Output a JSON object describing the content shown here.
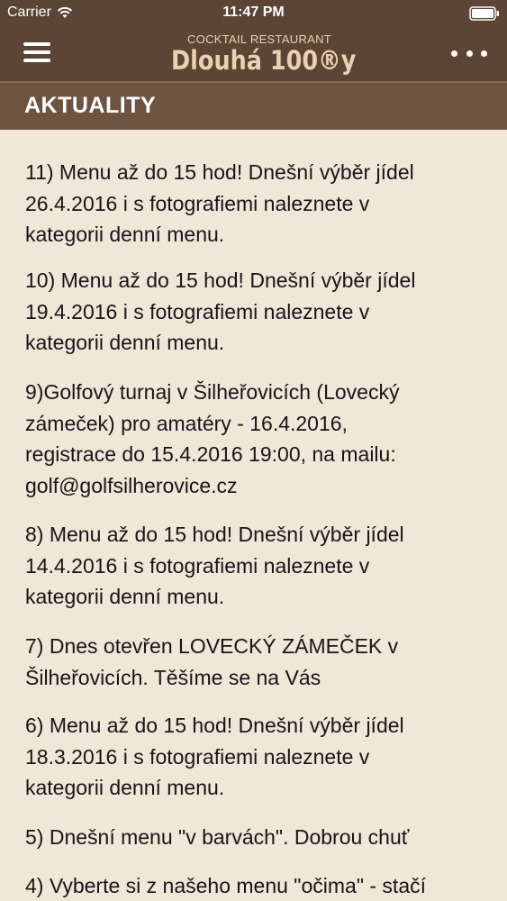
{
  "status_bar": {
    "carrier": "Carrier",
    "time": "11:47 PM"
  },
  "header": {
    "logo_top": "COCKTAIL RESTAURANT",
    "logo_main": "Dlouhá 100®y"
  },
  "section": {
    "title": "AKTUALITY"
  },
  "news": [
    "11) Menu až do 15 hod! Dnešní výběr jídel\n26.4.2016 i s fotografiemi naleznete v\nkategorii denní menu.",
    "10) Menu až do 15 hod! Dnešní výběr jídel\n19.4.2016 i s fotografiemi naleznete v\nkategorii denní menu.",
    "9)Golfový turnaj v Šilheřovicích (Lovecký\nzámeček) pro amatéry - 16.4.2016,\nregistrace do 15.4.2016 19:00, na mailu:\ngolf@golfsilherovice.cz",
    "8) Menu až do 15 hod! Dnešní výběr jídel\n14.4.2016 i s fotografiemi naleznete v\nkategorii denní menu.",
    "7) Dnes otevřen LOVECKÝ ZÁMEČEK v\nŠilheřovicích. Těšíme se na Vás",
    "6) Menu až do 15 hod! Dnešní výběr jídel\n18.3.2016 i s fotografiemi naleznete v\nkategorii denní menu.",
    "5) Dnešní menu \"v barvách\". Dobrou chuť",
    "4) Vyberte si z našeho menu \"očima\" - stačí"
  ],
  "colors": {
    "nav_bg": "#5c4535",
    "section_bg": "#6d5441",
    "content_bg": "#efe7d8",
    "logo": "#e8d2b0",
    "text": "#161616"
  },
  "icons": {
    "menu": "hamburger-icon",
    "more": "ellipsis-icon",
    "wifi": "wifi-icon",
    "battery": "battery-icon"
  }
}
